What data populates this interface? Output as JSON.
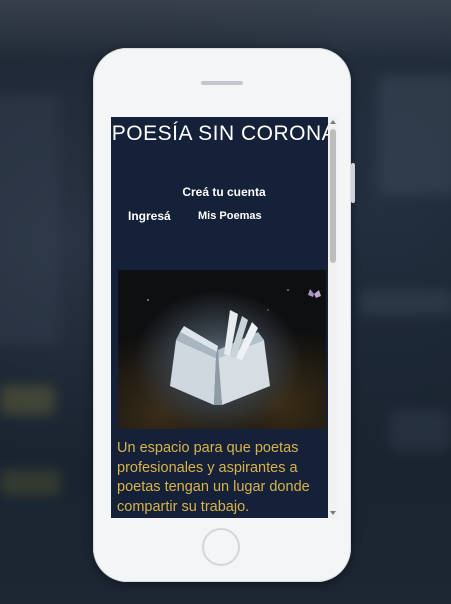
{
  "site": {
    "title": "POESÍA SIN CORONA",
    "create_account_label": "Creá tu cuenta",
    "nav": {
      "login_label": "Ingresá",
      "poems_label": "Mis Poemas"
    },
    "description": "Un espacio para que poetas profesionales y aspirantes a poetas tengan un lugar donde compartir su trabajo."
  },
  "hero_image": {
    "icon": "open-book-image"
  },
  "scrollbar": {
    "position": 0.0
  },
  "colors": {
    "screen_background": "#152139",
    "title_text": "#ffffff",
    "description_text": "#d9b34a",
    "phone_body": "#f4f5f7"
  }
}
